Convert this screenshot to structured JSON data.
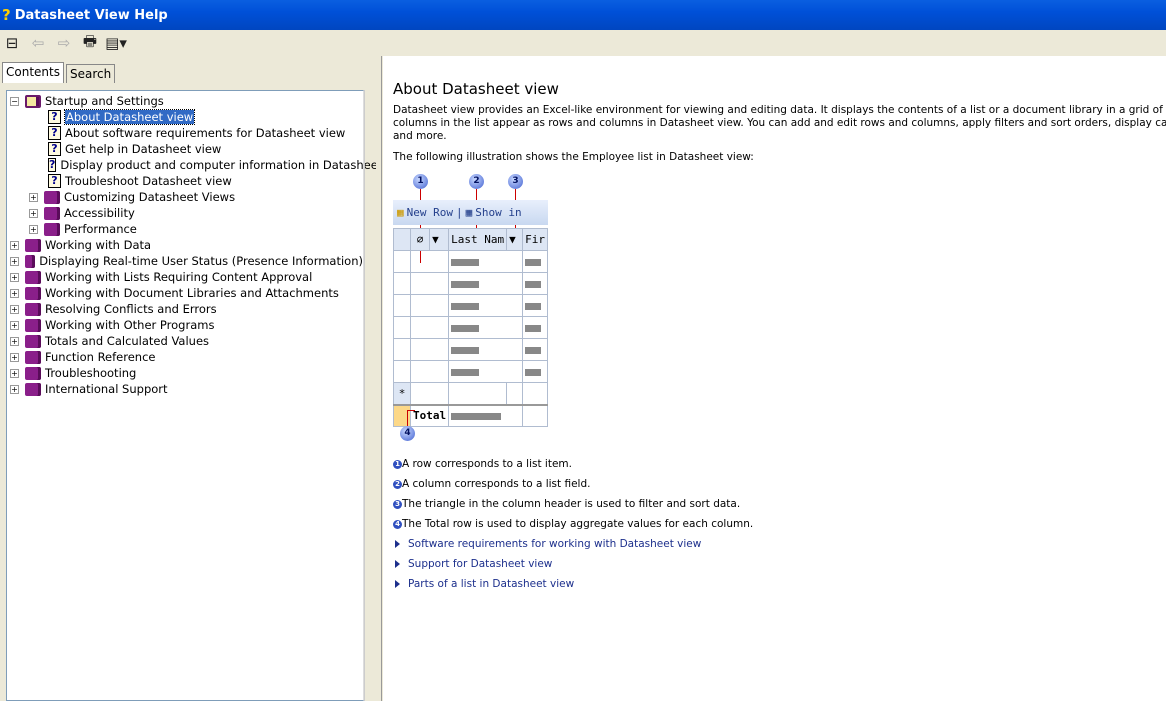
{
  "window": {
    "title": "Datasheet View Help"
  },
  "toolbar": [
    {
      "name": "hide-icon",
      "glyph": "⊟"
    },
    {
      "name": "back-icon",
      "glyph": "⇦"
    },
    {
      "name": "forward-icon",
      "glyph": "⇨"
    },
    {
      "name": "print-icon",
      "glyph": "🖶"
    },
    {
      "name": "options-icon",
      "glyph": "▤▾"
    }
  ],
  "tabs": [
    {
      "label": "Contents",
      "active": true
    },
    {
      "label": "Search",
      "active": false
    }
  ],
  "tree": [
    {
      "label": "Startup and Settings",
      "level": 0,
      "type": "book-open",
      "expander": "−"
    },
    {
      "label": "About Datasheet view",
      "level": 2,
      "type": "page",
      "selected": true
    },
    {
      "label": "About software requirements for Datasheet view",
      "level": 2,
      "type": "page"
    },
    {
      "label": "Get help in Datasheet view",
      "level": 2,
      "type": "page"
    },
    {
      "label": "Display product and computer information in Datasheet view",
      "level": 2,
      "type": "page"
    },
    {
      "label": "Troubleshoot Datasheet view",
      "level": 2,
      "type": "page"
    },
    {
      "label": "Customizing Datasheet Views",
      "level": 1,
      "type": "book",
      "expander": "+"
    },
    {
      "label": "Accessibility",
      "level": 1,
      "type": "book",
      "expander": "+"
    },
    {
      "label": "Performance",
      "level": 1,
      "type": "book",
      "expander": "+"
    },
    {
      "label": "Working with Data",
      "level": 0,
      "type": "book",
      "expander": "+"
    },
    {
      "label": "Displaying Real-time User Status (Presence Information)",
      "level": 0,
      "type": "book",
      "expander": "+"
    },
    {
      "label": "Working with Lists Requiring Content Approval",
      "level": 0,
      "type": "book",
      "expander": "+"
    },
    {
      "label": "Working with Document Libraries and Attachments",
      "level": 0,
      "type": "book",
      "expander": "+"
    },
    {
      "label": "Resolving Conflicts and Errors",
      "level": 0,
      "type": "book",
      "expander": "+"
    },
    {
      "label": "Working with Other Programs",
      "level": 0,
      "type": "book",
      "expander": "+"
    },
    {
      "label": "Totals and Calculated Values",
      "level": 0,
      "type": "book",
      "expander": "+"
    },
    {
      "label": "Function Reference",
      "level": 0,
      "type": "book",
      "expander": "+"
    },
    {
      "label": "Troubleshooting",
      "level": 0,
      "type": "book",
      "expander": "+"
    },
    {
      "label": "International Support",
      "level": 0,
      "type": "book",
      "expander": "+"
    }
  ],
  "content": {
    "title": "About Datasheet view",
    "para1": [
      "Datasheet view provides an Excel-like environment for viewing and editing data. It displays the contents of a list or a document library in a grid of rows and colum",
      "columns in the list appear as rows and columns in Datasheet view. You can add and edit rows and columns, apply filters and sort orders, display calculated values",
      "and more."
    ],
    "para2": "The following illustration shows the Employee list in Datasheet view:",
    "illustration": {
      "new_row": "New Row",
      "show_in": "Show in",
      "col_last": "Last Nam",
      "col_first": "Fir",
      "new_marker": "*",
      "total": "Total",
      "callouts": [
        "1",
        "2",
        "3",
        "4"
      ]
    },
    "notes": [
      {
        "n": "1",
        "text": "A row corresponds to a list item."
      },
      {
        "n": "2",
        "text": "A column corresponds to a list field."
      },
      {
        "n": "3",
        "text": "The triangle in the column header is used to filter and sort data."
      },
      {
        "n": "4",
        "text": "The Total row is used to display aggregate values for each column."
      }
    ],
    "links": [
      "Software requirements for working with Datasheet view",
      "Support for Datasheet view",
      "Parts of a list in Datasheet view"
    ]
  }
}
